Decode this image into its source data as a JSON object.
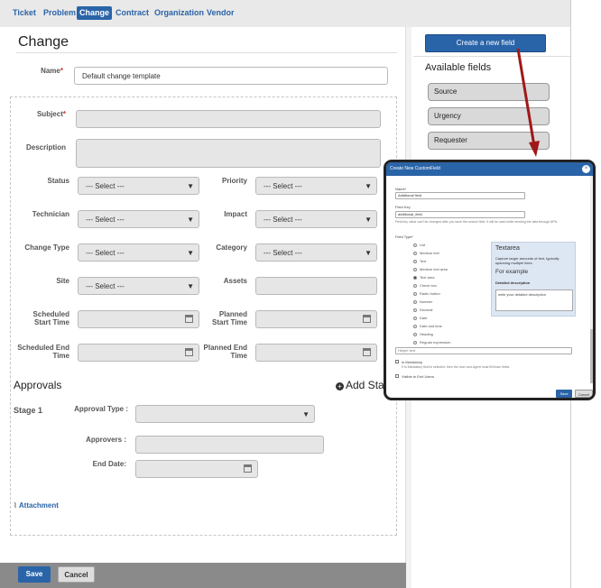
{
  "nav": {
    "tabs": [
      "Ticket",
      "Problem",
      "Change",
      "Contract",
      "Organization",
      "Vendor"
    ],
    "active": "Change"
  },
  "form": {
    "title": "Change",
    "name_label": "Name",
    "name_value": "Default change template",
    "subject_label": "Subject",
    "description_label": "Description",
    "status_label": "Status",
    "priority_label": "Priority",
    "technician_label": "Technician",
    "impact_label": "Impact",
    "change_type_label": "Change Type",
    "category_label": "Category",
    "site_label": "Site",
    "assets_label": "Assets",
    "sched_start_label": "Scheduled Start Time",
    "planned_start_label": "Planned Start Time",
    "sched_end_label": "Scheduled End Time",
    "planned_end_label": "Planned End Time",
    "select_placeholder": "--- Select ---",
    "required_mark": "*"
  },
  "approvals": {
    "title": "Approvals",
    "add_stage": "Add Stage",
    "stage_label": "Stage 1",
    "approval_type_label": "Approval Type :",
    "approvers_label": "Approvers :",
    "end_date_label": "End Date:"
  },
  "attachment_label": "Attachment",
  "footer": {
    "save": "Save",
    "cancel": "Cancel"
  },
  "right_panel": {
    "create_button": "Create a new field",
    "available_title": "Available fields",
    "fields": [
      "Source",
      "Urgency",
      "Requester"
    ]
  },
  "modal": {
    "title": "Create New CustomField",
    "name_label": "Name*",
    "name_value": "Additional field",
    "field_key_label": "Field Key",
    "field_key_value": "additional_field",
    "field_key_hint": "Field key value can't be changed after you save the custom field. It will be used while sending the data through APIs.",
    "field_type_label": "Field Type*",
    "types": [
      "List",
      "Medium text",
      "Text",
      "Medium text area",
      "Text area",
      "Check box",
      "Radio button",
      "Number",
      "Decimal",
      "Date",
      "Date and time",
      "Heading",
      "Regular expression"
    ],
    "selected_type": "Text area",
    "preview_title": "Textarea",
    "preview_desc": "Capture larger amounts of text, typically spanning multiple lines.",
    "preview_example": "For example",
    "preview_label": "Detailed description",
    "preview_placeholder": "write your detailed description",
    "helper_placeholder": "Helper text",
    "mandatory_label": "Is Mandatory",
    "mandatory_hint": "If Is Mandatory field is selected, then the User and Agent must fill those fields",
    "visible_label": "Visible to End Users",
    "save": "Save",
    "cancel": "Cancel"
  },
  "colors": {
    "accent": "#2a64a8",
    "arrow": "#a01818"
  }
}
